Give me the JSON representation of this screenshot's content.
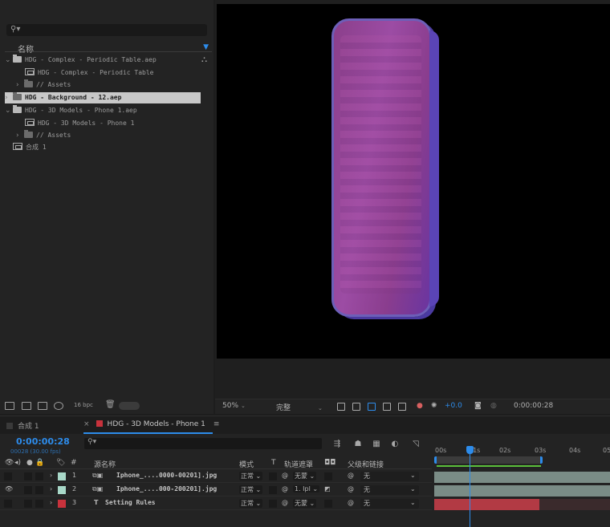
{
  "project": {
    "search_placeholder": "",
    "name_header": "名称",
    "items": [
      {
        "label": "HDG - Complex - Periodic Table.aep",
        "type": "folder"
      },
      {
        "label": "HDG - Complex - Periodic Table",
        "type": "comp"
      },
      {
        "label": "// Assets",
        "type": "folder"
      },
      {
        "label": "HDG - Background - 12.aep",
        "type": "folder",
        "selected": true
      },
      {
        "label": "HDG - 3D Models - Phone 1.aep",
        "type": "folder"
      },
      {
        "label": "HDG - 3D Models - Phone 1",
        "type": "comp"
      },
      {
        "label": "// Assets",
        "type": "folder"
      },
      {
        "label": "合成 1",
        "type": "comp"
      }
    ],
    "bpc": "16 bpc"
  },
  "viewer": {
    "zoom": "50%",
    "resolution": "完整",
    "exposure": "+0.0",
    "timecode": "0:00:00:28",
    "colors": {
      "phone_body": "#9c4ca4",
      "phone_edge": "#5a44b6"
    }
  },
  "timeline": {
    "tabs": [
      {
        "label": "合成 1",
        "color": "#3a3a3a"
      },
      {
        "label": "HDG - 3D Models - Phone 1",
        "color": "#c8323c",
        "active": true
      }
    ],
    "tab_menu": "≡",
    "timecode": "0:00:00:28",
    "timecode_sub": "00028 (30.00 fps)",
    "search_placeholder": "",
    "columns": {
      "num": "#",
      "source_name": "源名称",
      "mode": "模式",
      "t": "T",
      "track_matte": "轨道遮罩",
      "parent": "父级和链接"
    },
    "layers": [
      {
        "num": "1",
        "name": "Iphone_....0000-00201].jpg",
        "mode": "正常",
        "matte": "无蒙",
        "parent": "无",
        "color": "#a8d8c8",
        "visible": false
      },
      {
        "num": "2",
        "name": "Iphone_....000-200201].jpg",
        "mode": "正常",
        "matte": "1. Ipl",
        "parent": "无",
        "color": "#a8d8c8",
        "visible": true
      },
      {
        "num": "3",
        "name": "Setting Rules",
        "mode": "正常",
        "matte": "无蒙",
        "parent": "无",
        "color": "#c8323c",
        "visible": false
      }
    ],
    "ruler_ticks": [
      "00s",
      "01s",
      "02s",
      "03s",
      "04s",
      "05"
    ],
    "bar_colors": [
      "#7a8c86",
      "#7a8c86",
      "#b23a44"
    ]
  }
}
